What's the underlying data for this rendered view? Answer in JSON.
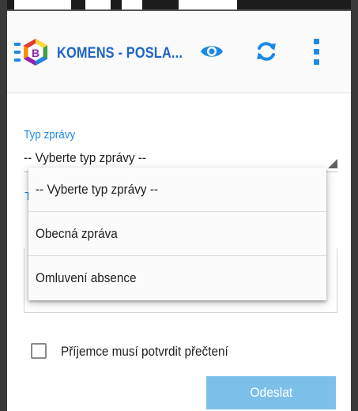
{
  "toolbar": {
    "title": "KOMENS - POSLA...",
    "icons": [
      "menu-icon",
      "komens-logo-icon",
      "eye-icon",
      "refresh-icon",
      "more-vert-icon"
    ],
    "accent_color": "#1e88e5"
  },
  "form": {
    "message_type_label": "Typ zprávy",
    "message_type_value": "-- Vyberte typ zprávy --",
    "hidden_label_fragment": "T",
    "dropdown_options": [
      "-- Vyberte typ zprávy --",
      "Obecná zpráva",
      "Omluvení absence"
    ],
    "confirm_read_label": "Příjemce musí potvrdit přečtení",
    "confirm_read_checked": false,
    "send_label": "Odeslat"
  }
}
